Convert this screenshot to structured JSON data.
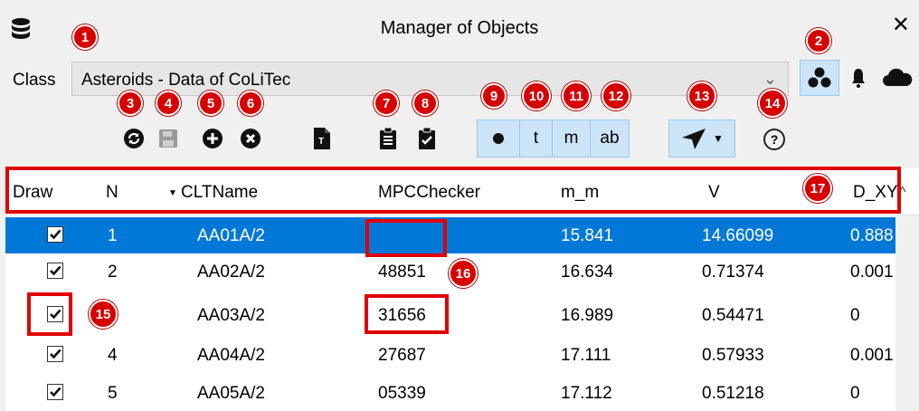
{
  "window": {
    "title": "Manager of Objects",
    "close_glyph": "✕"
  },
  "class_selector": {
    "label": "Class",
    "value": "Asteroids - Data of CoLiTec"
  },
  "mode_buttons": [
    "t",
    "m",
    "ab"
  ],
  "badges": [
    "1",
    "2",
    "3",
    "4",
    "5",
    "6",
    "7",
    "8",
    "9",
    "10",
    "11",
    "12",
    "13",
    "14",
    "15",
    "16",
    "17"
  ],
  "table": {
    "columns": [
      "Draw",
      "N",
      "CLTName",
      "MPCChecker",
      "m_m",
      "V",
      "D_XY"
    ],
    "rows": [
      {
        "checked": true,
        "n": "1",
        "name": "AA01A/2",
        "mpc": "",
        "m": "15.841",
        "v": "14.66099",
        "dxy": "0.888"
      },
      {
        "checked": true,
        "n": "2",
        "name": "AA02A/2",
        "mpc": "48851",
        "m": "16.634",
        "v": "0.71374",
        "dxy": "0.001"
      },
      {
        "checked": true,
        "n": "3",
        "name": "AA03A/2",
        "mpc": "31656",
        "m": "16.989",
        "v": "0.54471",
        "dxy": "0"
      },
      {
        "checked": true,
        "n": "4",
        "name": "AA04A/2",
        "mpc": "27687",
        "m": "17.111",
        "v": "0.57933",
        "dxy": "0.001"
      },
      {
        "checked": true,
        "n": "5",
        "name": "AA05A/2",
        "mpc": "05339",
        "m": "17.112",
        "v": "0.51218",
        "dxy": "0"
      }
    ],
    "selected_row": 0
  },
  "colors": {
    "selection": "#0078d7",
    "badge": "#d60000",
    "highlight": "#e00000",
    "toggle_bg": "#cce4f7"
  },
  "icons": [
    "database-icon",
    "close-icon",
    "cluster-icon",
    "bell-icon",
    "cloud-icon",
    "refresh-icon",
    "save-icon",
    "add-icon",
    "delete-icon",
    "text-file-icon",
    "clipboard-icon",
    "clipboard-check-icon",
    "dot-icon",
    "navigate-icon",
    "help-icon"
  ]
}
